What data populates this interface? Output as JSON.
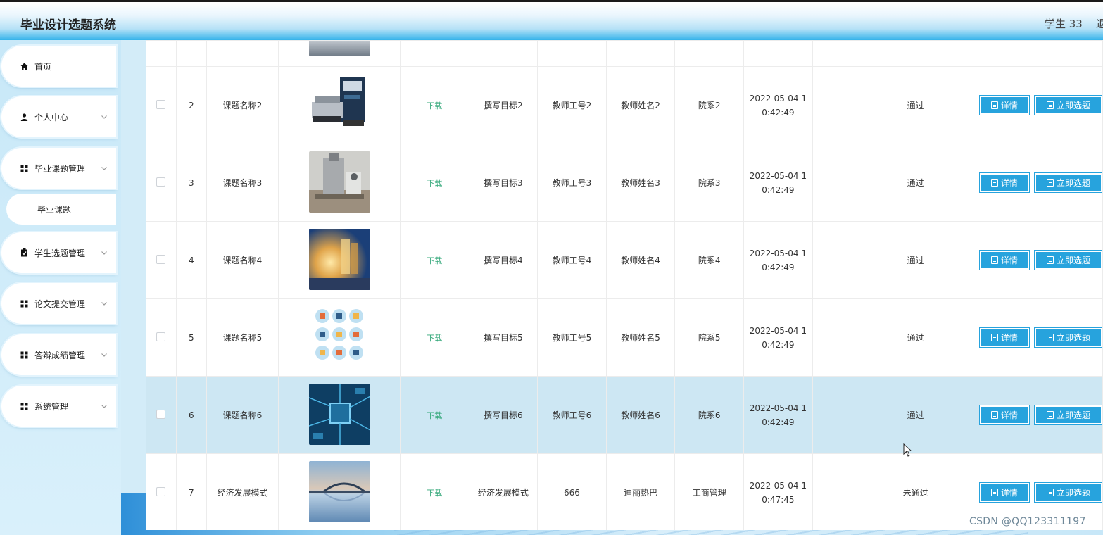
{
  "header": {
    "title": "毕业设计选题系统",
    "user": "学生 33",
    "logout": "退出登录"
  },
  "sidebar": {
    "items": [
      {
        "label": "首页",
        "icon": "home-icon"
      },
      {
        "label": "个人中心",
        "icon": "user-icon"
      },
      {
        "label": "毕业课题管理",
        "icon": "grid-icon"
      },
      {
        "label": "学生选题管理",
        "icon": "clipboard-icon"
      },
      {
        "label": "论文提交管理",
        "icon": "grid-icon"
      },
      {
        "label": "答辩成绩管理",
        "icon": "grid-icon"
      },
      {
        "label": "系统管理",
        "icon": "grid-icon"
      }
    ],
    "submenu": {
      "label": "毕业课题"
    }
  },
  "table": {
    "download_label": "下载",
    "detail_label": "详情",
    "choose_label": "立即选题",
    "rows": [
      {
        "index": "2",
        "name": "课题名称2",
        "goal": "撰写目标2",
        "teacher_id": "教师工号2",
        "teacher_name": "教师姓名2",
        "dept": "院系2",
        "date1": "2022-05-04 1",
        "date2": "0:42:49",
        "status": "通过",
        "image": "lab-machine"
      },
      {
        "index": "3",
        "name": "课题名称3",
        "goal": "撰写目标3",
        "teacher_id": "教师工号3",
        "teacher_name": "教师姓名3",
        "dept": "院系3",
        "date1": "2022-05-04 1",
        "date2": "0:42:49",
        "status": "通过",
        "image": "lab-apparatus"
      },
      {
        "index": "4",
        "name": "课题名称4",
        "goal": "撰写目标4",
        "teacher_id": "教师工号4",
        "teacher_name": "教师姓名4",
        "dept": "院系4",
        "date1": "2022-05-04 1",
        "date2": "0:42:49",
        "status": "通过",
        "image": "lab-glassware"
      },
      {
        "index": "5",
        "name": "课题名称5",
        "goal": "撰写目标5",
        "teacher_id": "教师工号5",
        "teacher_name": "教师姓名5",
        "dept": "院系5",
        "date1": "2022-05-04 1",
        "date2": "0:42:49",
        "status": "通过",
        "image": "science-icons"
      },
      {
        "index": "6",
        "name": "课题名称6",
        "goal": "撰写目标6",
        "teacher_id": "教师工号6",
        "teacher_name": "教师姓名6",
        "dept": "院系6",
        "date1": "2022-05-04 1",
        "date2": "0:42:49",
        "status": "通过",
        "image": "circuit-board"
      },
      {
        "index": "7",
        "name": "经济发展模式",
        "goal": "经济发展模式",
        "teacher_id": "666",
        "teacher_name": "迪丽热巴",
        "dept": "工商管理",
        "date1": "2022-05-04 1",
        "date2": "0:47:45",
        "status": "未通过",
        "image": "bridge-landscape"
      }
    ]
  },
  "watermark": "CSDN @QQ123311197",
  "colors": {
    "accent": "#27a3dd",
    "download": "#34a87a",
    "highlight_row": "#cde7f3"
  }
}
